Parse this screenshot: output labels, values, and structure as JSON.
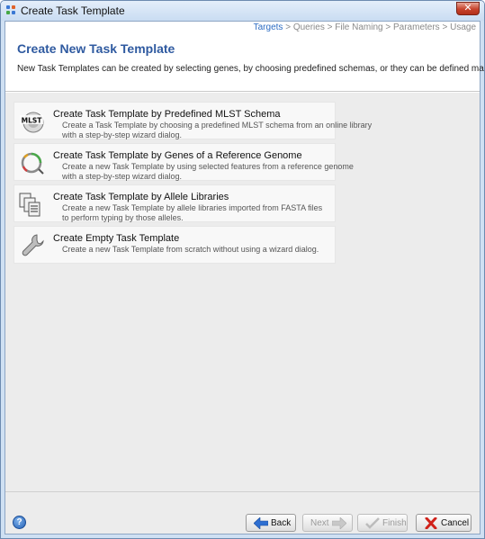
{
  "window": {
    "title": "Create Task Template",
    "close_label": "✕"
  },
  "steps": {
    "items": [
      "Targets",
      "Queries",
      "File Naming",
      "Parameters",
      "Usage"
    ],
    "separator": ">"
  },
  "header": {
    "title": "Create New Task Template",
    "description": "New Task Templates can be created by selecting genes, by choosing predefined schemas, or they can be defined manually 'from scratch'."
  },
  "options": [
    {
      "title": "Create Task Template by Predefined MLST Schema",
      "desc1": "Create a Task Template by choosing a predefined MLST schema from an online library",
      "desc2": "with a step-by-step wizard dialog.",
      "icon": "mlst-icon",
      "icon_text": "MLST"
    },
    {
      "title": "Create Task Template by Genes of a Reference Genome",
      "desc1": "Create a new Task Template by using selected features from a reference genome",
      "desc2": "with a step-by-step wizard dialog.",
      "icon": "genome-icon"
    },
    {
      "title": "Create Task Template by Allele Libraries",
      "desc1": "Create a new Task Template by allele libraries imported from FASTA files",
      "desc2": "to perform typing by those alleles.",
      "icon": "allele-library-icon"
    },
    {
      "title": "Create Empty Task Template",
      "desc1": "Create a new Task Template from scratch without using a wizard dialog.",
      "desc2": "",
      "icon": "wrench-icon"
    }
  ],
  "footer": {
    "help_label": "?",
    "back_label": "Back",
    "next_label": "Next",
    "finish_label": "Finish",
    "cancel_label": "Cancel"
  },
  "colors": {
    "accent": "#2f5aa0",
    "active_step": "#2c6cc3",
    "inactive_step": "#8a8a8a",
    "cancel_icon": "#d0221a",
    "back_icon": "#2e6fd1"
  }
}
